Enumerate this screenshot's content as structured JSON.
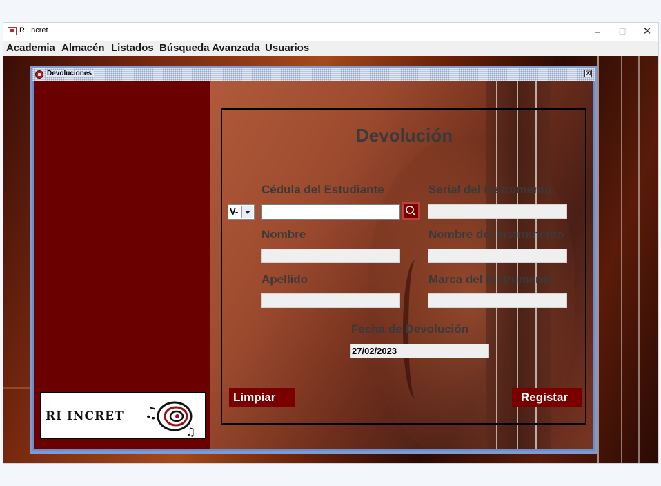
{
  "window": {
    "title": "RI Incret",
    "minimize": "–",
    "maximize": "☐",
    "close": "✕"
  },
  "menu": [
    "Academia",
    "Almacén",
    "Listados",
    "Búsqueda Avanzada",
    "Usuarios"
  ],
  "internal_frame": {
    "title": "Devoluciones",
    "close": "⊠"
  },
  "logo": {
    "text": "RI INCRET"
  },
  "form": {
    "heading": "Devolución",
    "cedula_label": "Cédula del Estudiante",
    "id_prefix": "V-",
    "cedula_value": "",
    "nombre_label": "Nombre",
    "nombre_value": "",
    "apellido_label": "Apellido",
    "apellido_value": "",
    "serial_label": "Serial del Instrumento",
    "serial_value": "",
    "nombre_instr_label": "Nombre del Instrumento",
    "nombre_instr_value": "",
    "marca_label": "Marca del Instrumento",
    "marca_value": "",
    "fecha_label": "Fecha de Devolución",
    "fecha_value": "27/02/2023",
    "clear_button": "Limpiar",
    "submit_button": "Registar"
  },
  "colors": {
    "accent": "#7a0000",
    "sidebar": "#6b0000",
    "frame_border": "#7d9bd1"
  }
}
